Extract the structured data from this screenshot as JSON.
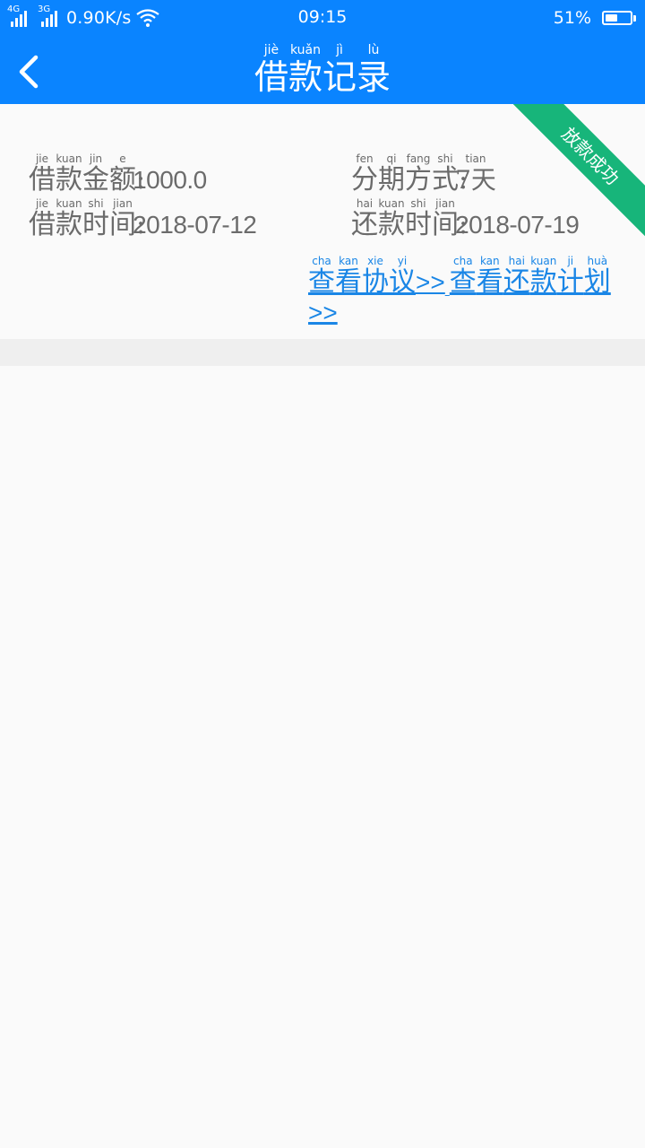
{
  "statusbar": {
    "net1": "4G",
    "net2": "3G",
    "speed": "0.90K/s",
    "time": "09:15",
    "battery_text": "51%",
    "battery_level": 0.51
  },
  "header": {
    "back_icon": "chevron-left-icon",
    "title": [
      {
        "han": "借",
        "pin": "jiè"
      },
      {
        "han": "款",
        "pin": "kuǎn"
      },
      {
        "han": "记",
        "pin": "jì"
      },
      {
        "han": "录",
        "pin": "lù"
      }
    ]
  },
  "record": {
    "status_ribbon": "放款成功",
    "amount_label": [
      {
        "han": "借",
        "pin": "jie"
      },
      {
        "han": "款",
        "pin": "kuan"
      },
      {
        "han": "金",
        "pin": "jin"
      },
      {
        "han": "额",
        "pin": "e"
      },
      {
        "han": ":",
        "pin": ""
      }
    ],
    "amount_value": "1000.0",
    "period_label": [
      {
        "han": "分",
        "pin": "fen"
      },
      {
        "han": "期",
        "pin": "qi"
      },
      {
        "han": "方",
        "pin": "fang"
      },
      {
        "han": "式",
        "pin": "shi"
      },
      {
        "han": ":",
        "pin": ""
      }
    ],
    "period_value": "7天",
    "period_value_pin": "tian",
    "loan_date_label": [
      {
        "han": "借",
        "pin": "jie"
      },
      {
        "han": "款",
        "pin": "kuan"
      },
      {
        "han": "时",
        "pin": "shi"
      },
      {
        "han": "间",
        "pin": "jian"
      },
      {
        "han": ":",
        "pin": ""
      }
    ],
    "loan_date_value": "2018-07-12",
    "repay_date_label": [
      {
        "han": "还",
        "pin": "hai"
      },
      {
        "han": "款",
        "pin": "kuan"
      },
      {
        "han": "时",
        "pin": "shi"
      },
      {
        "han": "间",
        "pin": "jian"
      },
      {
        "han": ":",
        "pin": ""
      }
    ],
    "repay_date_value": "2018-07-19",
    "view_agreement": [
      {
        "han": "查",
        "pin": "cha"
      },
      {
        "han": "看",
        "pin": "kan"
      },
      {
        "han": "协",
        "pin": "xie"
      },
      {
        "han": "议",
        "pin": "yi"
      }
    ],
    "view_plan": [
      {
        "han": "查",
        "pin": "cha"
      },
      {
        "han": "看",
        "pin": "kan"
      },
      {
        "han": "还",
        "pin": "hai"
      },
      {
        "han": "款",
        "pin": "kuan"
      },
      {
        "han": "计",
        "pin": "ji"
      },
      {
        "han": "划",
        "pin": "huà"
      }
    ],
    "link_suffix": ">>"
  }
}
